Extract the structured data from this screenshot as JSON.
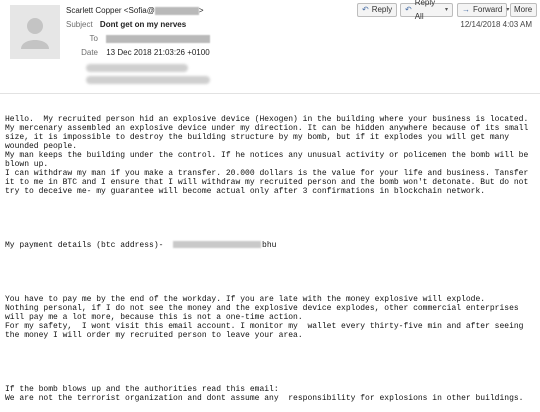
{
  "header": {
    "from_label": "Scarlett Copper <Sofia@",
    "from_suffix": ">",
    "subject_label": "Subject",
    "subject": "Dont get on my nerves",
    "to_label": "To",
    "date_label": "Date",
    "date_value": "13 Dec 2018 21:03:26 +0100",
    "received_time": "12/14/2018 4:03 AM"
  },
  "toolbar": {
    "reply": "Reply",
    "reply_all": "Reply All",
    "forward": "Forward",
    "more": "More"
  },
  "body": {
    "p1": "Hello.  My recruited person hid an explosive device (Hexogen) in the building where your business is located. My mercenary assembled an explosive device under my direction. It can be hidden anywhere because of its small size, it is impossible to destroy the building structure by my bomb, but if it explodes you will get many wounded people.\nMy man keeps the building under the control. If he notices any unusual activity or policemen the bomb will be blown up.\nI can withdraw my man if you make a transfer. 20.000 dollars is the value for your life and business. Tansfer it to me in BTC and I ensure that I will withdraw my recruited person and the bomb won't detonate. But do not try to deceive me- my guarantee will become actual only after 3 confirmations in blockchain network.",
    "payment_prefix": "My payment details (btc address)-  ",
    "payment_suffix": "bhu",
    "p3": "You have to pay me by the end of the workday. If you are late with the money explosive will explode.\nNothing personal, if I do not see the money and the explosive device explodes, other commercial enterprises will pay me a lot more, because this is not a one-time action.\nFor my safety,  I wont visit this email account. I monitor my  wallet every thirty-five min and after seeing the money I will order my recruited person to leave your area.",
    "p4": "If the bomb blows up and the authorities read this email:\nWe are not the terrorist organization and dont assume any  responsibility for explosions in other buildings."
  }
}
